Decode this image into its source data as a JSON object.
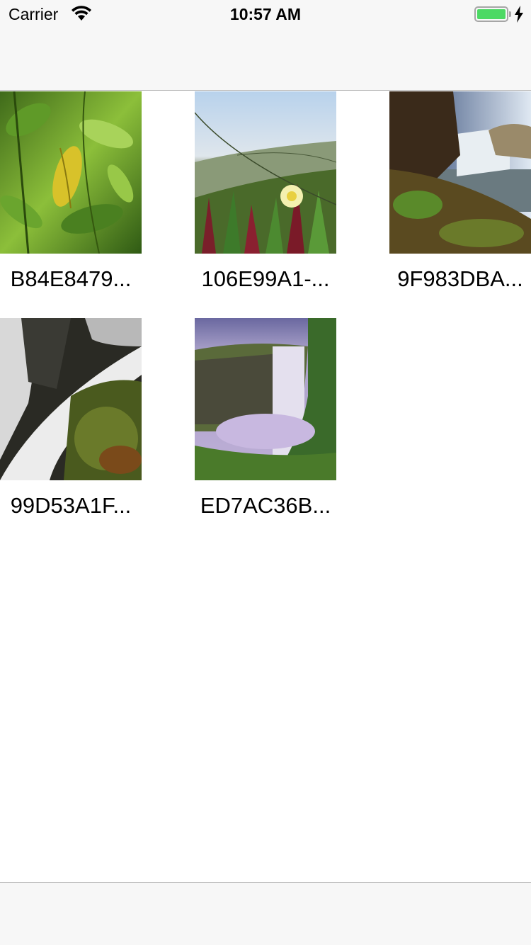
{
  "status_bar": {
    "carrier": "Carrier",
    "time": "10:57 AM",
    "battery_color": "#4cd964"
  },
  "photos": [
    {
      "caption": "B84E8479...",
      "thumbnail": "leaf-photo"
    },
    {
      "caption": "106E99A1-...",
      "thumbnail": "flower-photo"
    },
    {
      "caption": "9F983DBA...",
      "thumbnail": "waterfall-cliff-photo"
    },
    {
      "caption": "99D53A1F...",
      "thumbnail": "waterfall-rocks-photo"
    },
    {
      "caption": "ED7AC36B...",
      "thumbnail": "waterfall-valley-photo"
    }
  ]
}
